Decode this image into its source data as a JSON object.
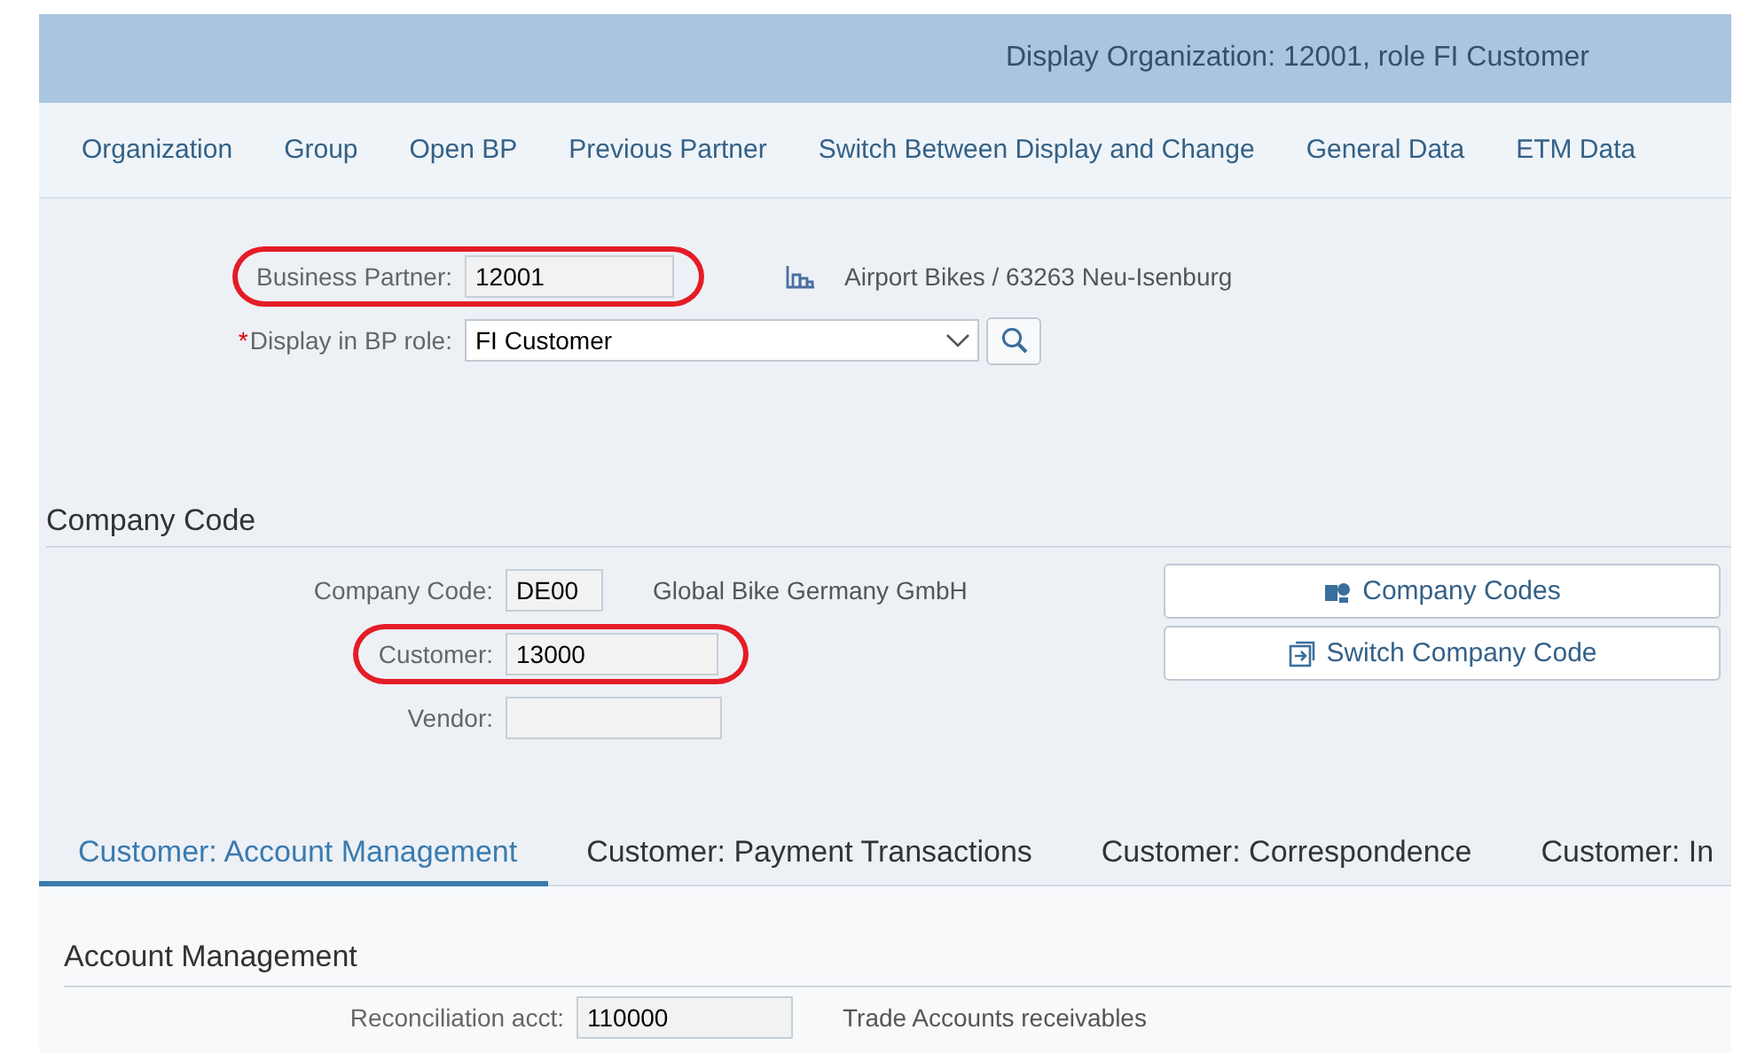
{
  "window": {
    "title": "Display Organization: 12001, role FI Customer"
  },
  "toolbar": [
    "Organization",
    "Group",
    "Open BP",
    "Previous Partner",
    "Switch Between Display and Change",
    "General Data",
    "ETM Data"
  ],
  "header_fields": [
    {
      "kind": "field",
      "label": "Business Partner:",
      "value": "12001",
      "highlighted": true,
      "description": "Airport Bikes / 63263 Neu-Isenburg"
    },
    {
      "kind": "dropdown",
      "required_marker": "*",
      "label": "Display in BP role:",
      "value": "FI Customer",
      "highlighted": false
    }
  ],
  "company_code": {
    "title": "Company Code",
    "fields": [
      {
        "label": "Company Code:",
        "value": "DE00",
        "highlighted": false,
        "description": "Global Bike Germany GmbH"
      },
      {
        "label": "Customer:",
        "value": "13000",
        "highlighted": true
      },
      {
        "label": "Vendor:",
        "highlighted": false
      }
    ],
    "buttons": [
      "Company Codes",
      "Switch Company Code"
    ]
  },
  "tabs": [
    {
      "label": "Customer: Account Management",
      "selected": true
    },
    {
      "label": "Customer: Payment Transactions",
      "selected": false
    },
    {
      "label": "Customer: Correspondence",
      "selected": false
    },
    {
      "label": "Customer: In",
      "selected": false
    }
  ],
  "account_management": {
    "title": "Account Management",
    "fields": [
      {
        "label": "Reconciliation acct:",
        "value": "110000",
        "description": "Trade Accounts receivables"
      }
    ]
  }
}
